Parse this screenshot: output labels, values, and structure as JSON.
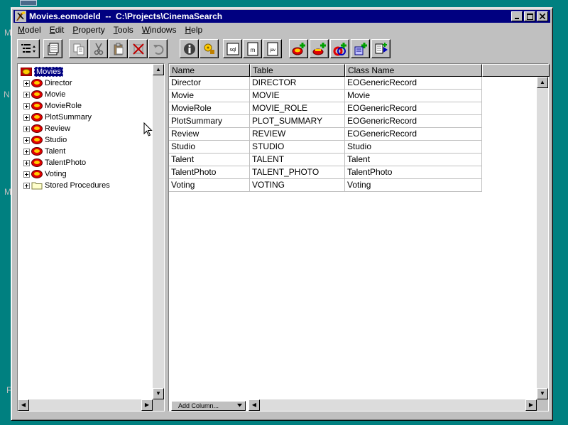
{
  "desktop": {
    "edge_letters": [
      "M",
      "N",
      "M",
      "F"
    ]
  },
  "window": {
    "title": "Movies.eomodeld  --  C:\\Projects\\CinemaSearch",
    "buttons": {
      "minimize": "_",
      "maximize": "□",
      "close": "✕"
    }
  },
  "menu": [
    {
      "label": "Model",
      "accel": "M"
    },
    {
      "label": "Edit",
      "accel": "E"
    },
    {
      "label": "Property",
      "accel": "P"
    },
    {
      "label": "Tools",
      "accel": "T"
    },
    {
      "label": "Windows",
      "accel": "W"
    },
    {
      "label": "Help",
      "accel": "H"
    }
  ],
  "toolbar_icons": [
    "outline-view-icon",
    "browser-view-icon",
    "copy-icon",
    "cut-icon",
    "paste-icon",
    "delete-icon",
    "undo-icon",
    "info-icon",
    "key-icon",
    "sql-icon",
    "m-file-icon",
    "java-file-icon",
    "add-entity-icon",
    "add-attribute-icon",
    "add-relationship-icon",
    "add-fetch-spec-icon",
    "add-stored-procedure-icon"
  ],
  "tree": {
    "root": "Movies",
    "entities": [
      "Director",
      "Movie",
      "MovieRole",
      "PlotSummary",
      "Review",
      "Studio",
      "Talent",
      "TalentPhoto",
      "Voting"
    ],
    "folder": "Stored Procedures"
  },
  "table": {
    "columns": [
      "Name",
      "Table",
      "Class Name"
    ],
    "rows": [
      [
        "Director",
        "DIRECTOR",
        "EOGenericRecord"
      ],
      [
        "Movie",
        "MOVIE",
        "Movie"
      ],
      [
        "MovieRole",
        "MOVIE_ROLE",
        "EOGenericRecord"
      ],
      [
        "PlotSummary",
        "PLOT_SUMMARY",
        "EOGenericRecord"
      ],
      [
        "Review",
        "REVIEW",
        "EOGenericRecord"
      ],
      [
        "Studio",
        "STUDIO",
        "Studio"
      ],
      [
        "Talent",
        "TALENT",
        "Talent"
      ],
      [
        "TalentPhoto",
        "TALENT_PHOTO",
        "TalentPhoto"
      ],
      [
        "Voting",
        "VOTING",
        "Voting"
      ]
    ]
  },
  "footer": {
    "add_column_label": "Add Column..."
  },
  "colors": {
    "desktop": "#008080",
    "title_bar": "#000080",
    "chrome": "#c0c0c0"
  }
}
